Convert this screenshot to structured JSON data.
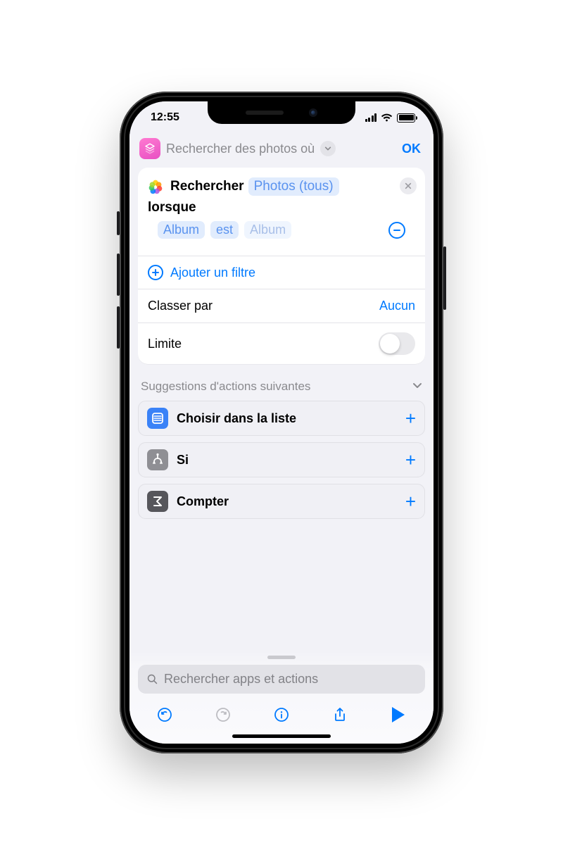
{
  "status": {
    "time": "12:55"
  },
  "nav": {
    "title": "Rechercher des photos où",
    "done": "OK"
  },
  "action": {
    "verb": "Rechercher",
    "source": "Photos (tous)",
    "when": "lorsque",
    "filter": {
      "field": "Album",
      "op": "est",
      "value_placeholder": "Album"
    },
    "add_filter": "Ajouter un filtre",
    "sort_label": "Classer par",
    "sort_value": "Aucun",
    "limit_label": "Limite",
    "limit_on": false
  },
  "suggestions": {
    "header": "Suggestions d'actions suivantes",
    "items": [
      {
        "id": "choose-from-list",
        "label": "Choisir dans la liste"
      },
      {
        "id": "if",
        "label": "Si"
      },
      {
        "id": "count",
        "label": "Compter"
      }
    ]
  },
  "search": {
    "placeholder": "Rechercher apps et actions"
  }
}
